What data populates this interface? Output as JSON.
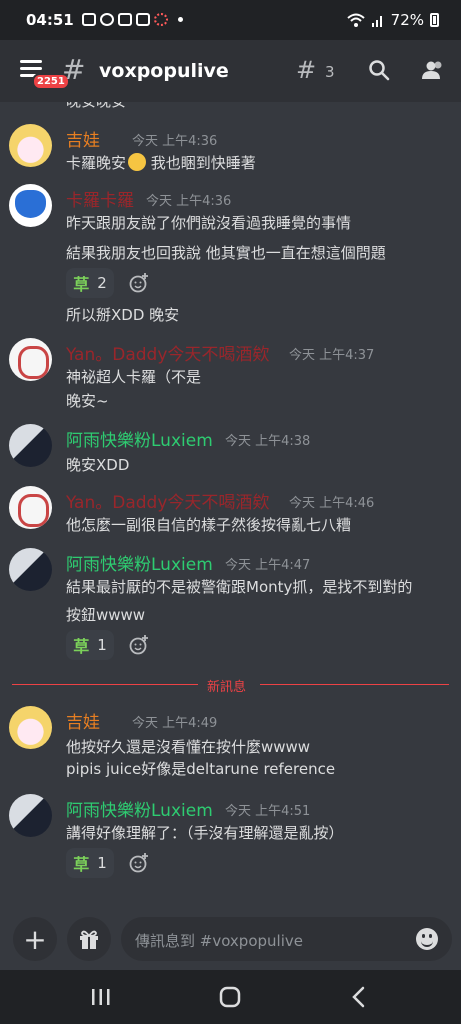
{
  "status": {
    "time": "04:51",
    "battery": "72%"
  },
  "header": {
    "badge": "2251",
    "hash": "#",
    "channel": "voxpopulive",
    "threads_icon": "#",
    "thread_count": "3"
  },
  "cutoff_text": "晚安晚安",
  "messages": [
    {
      "author": "吉娃",
      "author_color": "#e67e22",
      "time": "今天 上午4:36",
      "lines": [
        "卡羅晚安",
        " 我也睏到快睡著"
      ]
    },
    {
      "author": "卡羅卡羅",
      "author_color": "#99262b",
      "time": "今天 上午4:36",
      "lines": [
        "昨天跟朋友說了你們說沒看過我睡覺的事情",
        "結果我朋友也回我說 他其實也一直在想這個問題"
      ],
      "reaction": {
        "emoji": "草",
        "count": "2"
      },
      "after": "所以掰XDD 晚安"
    },
    {
      "author": "Yan。Daddy今天不喝酒欸",
      "author_color": "#99262b",
      "time": "今天 上午4:37",
      "lines": [
        "神祕超人卡羅（不是",
        "晚安~"
      ]
    },
    {
      "author": "阿雨快樂粉Luxiem",
      "author_color": "#2ecc71",
      "time": "今天 上午4:38",
      "lines": [
        "晚安XDD"
      ]
    },
    {
      "author": "Yan。Daddy今天不喝酒欸",
      "author_color": "#99262b",
      "time": "今天 上午4:46",
      "lines": [
        "他怎麼一副很自信的樣子然後按得亂七八糟"
      ]
    },
    {
      "author": "阿雨快樂粉Luxiem",
      "author_color": "#2ecc71",
      "time": "今天 上午4:47",
      "lines": [
        "結果最討厭的不是被警衛跟Monty抓，是找不到對的",
        "按鈕wwww"
      ],
      "reaction": {
        "emoji": "草",
        "count": "1"
      }
    },
    {
      "author": "吉娃",
      "author_color": "#e67e22",
      "time": "今天 上午4:49",
      "lines": [
        "他按好久還是沒看懂在按什麼wwww",
        "pipis juice好像是deltarune reference"
      ]
    },
    {
      "author": "阿雨快樂粉Luxiem",
      "author_color": "#2ecc71",
      "time": "今天 上午4:51",
      "lines": [
        "講得好像理解了：（手沒有理解還是亂按）"
      ],
      "reaction": {
        "emoji": "草",
        "count": "1"
      }
    }
  ],
  "new_messages_label": "新訊息",
  "composer": {
    "placeholder": "傳訊息到 #voxpopulive",
    "plus": "+",
    "gift_icon": "gift-icon"
  },
  "colors": {
    "background": "#36393f",
    "header": "#2f3136",
    "nav": "#202225",
    "new_divider": "#ed4245"
  }
}
